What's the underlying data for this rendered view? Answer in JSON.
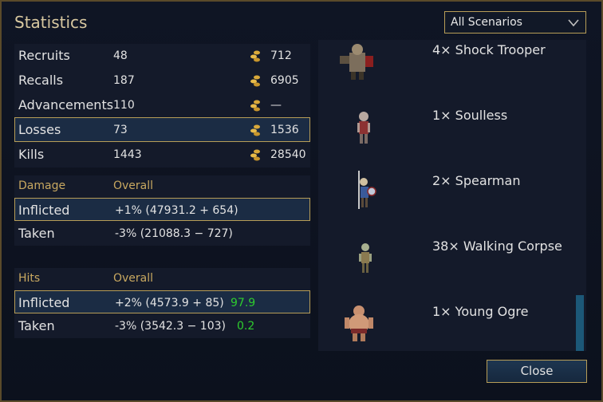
{
  "dialog": {
    "title": "Statistics"
  },
  "scenario_select": {
    "selected": "All Scenarios"
  },
  "summary": [
    {
      "label": "Recruits",
      "count": "48",
      "gold": "712"
    },
    {
      "label": "Recalls",
      "count": "187",
      "gold": "6905"
    },
    {
      "label": "Advancements",
      "count": "110",
      "gold": "—"
    },
    {
      "label": "Losses",
      "count": "73",
      "gold": "1536",
      "selected": true
    },
    {
      "label": "Kills",
      "count": "1443",
      "gold": "28540"
    }
  ],
  "damage": {
    "header": "Damage",
    "overall_header": "Overall",
    "rows": [
      {
        "label": "Inflicted",
        "value": "+1% (47931.2 + 654)"
      },
      {
        "label": "Taken",
        "value": "-3% (21088.3 − 727)"
      }
    ]
  },
  "hits": {
    "header": "Hits",
    "overall_header": "Overall",
    "rows": [
      {
        "label": "Inflicted",
        "value": "+2% (4573.9 + 85)",
        "rating": "97.9"
      },
      {
        "label": "Taken",
        "value": "-3% (3542.3 − 103)",
        "rating": "0.2"
      }
    ]
  },
  "units": [
    {
      "name": "4× Shock Trooper",
      "icon": "shock-trooper-icon"
    },
    {
      "name": "1× Soulless",
      "icon": "soulless-icon"
    },
    {
      "name": "2× Spearman",
      "icon": "spearman-icon"
    },
    {
      "name": "38× Walking Corpse",
      "icon": "walking-corpse-icon"
    },
    {
      "name": "1× Young Ogre",
      "icon": "young-ogre-icon"
    }
  ],
  "close_button": {
    "label": "Close"
  },
  "colors": {
    "gold_border": "#b79d57",
    "title": "#d8c8a0",
    "header": "#c8a860",
    "good": "#2ecc2e",
    "selected_bg": "#1b2c44"
  }
}
